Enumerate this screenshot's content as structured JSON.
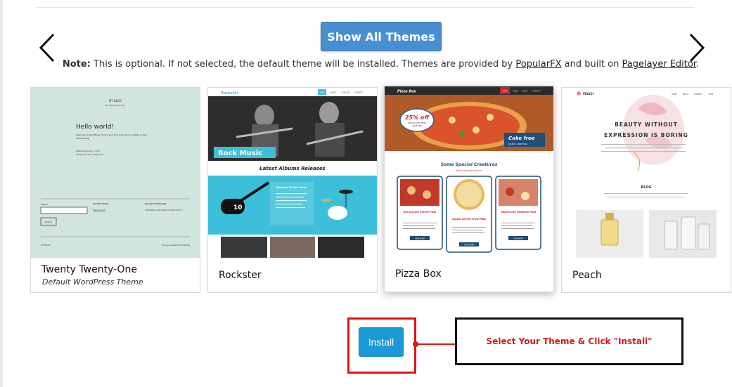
{
  "nav": {
    "prev_icon": "chevron-left-icon",
    "next_icon": "chevron-right-icon"
  },
  "show_all_button": "Show All Themes",
  "note": {
    "label": "Note:",
    "text1": " This is optional. If not selected, the default theme will be installed. Themes are provided by ",
    "link1": "PopularFX",
    "text2": " and built on ",
    "link2": "Pagelayer Editor",
    "text3": "."
  },
  "themes": [
    {
      "name": "Twenty Twenty-One",
      "subtitle": "Default WordPress Theme",
      "preview": {
        "site_title": "MY BLOG",
        "site_tagline": "My WordPress Blog",
        "post_title": "Hello world!",
        "post_excerpt1": "Welcome to WordPress. This is your first post. Edit or delete it, then",
        "post_excerpt2": "start writing!",
        "post_meta1": "Published January 3, 2022",
        "post_meta2": "Categorized as Uncategorized",
        "search_label": "Search",
        "search_button": "Search",
        "recent_posts_title": "Recent Posts",
        "recent_posts_item": "Hello world!",
        "recent_comments_title": "Recent Comments",
        "recent_comments_item": "A WordPress Commenter on Hello world!",
        "footer_left": "MY BLOG",
        "footer_right": "Proudly powered by WordPress"
      },
      "bg": "#d1e4dd"
    },
    {
      "name": "Rockster",
      "subtitle": "",
      "preview": {
        "logo": "Rockster",
        "menu": [
          "HOME",
          "ABOUT",
          "GALLERY",
          "CONTACT"
        ],
        "hero_label": "Rock Music",
        "section_title": "Latest Albums Releases",
        "band_title": "Welcome To Our Band"
      },
      "accent": "#3dbfd9"
    },
    {
      "name": "Pizza Box",
      "subtitle": "",
      "preview": {
        "logo": "Pizza Box",
        "menu": [
          "HOME",
          "MENU",
          "BLOG",
          "CONTACT"
        ],
        "badge_big": "25% off",
        "badge_line1": "ON YOUR FIRST ORDER",
        "badge_line2": "LARGE PIZZA",
        "promo_title": "Coke free",
        "promo_sub": "ON ANY LARGE PIZZA",
        "section_title": "Some Special Creatures",
        "section_sub": "WHAT WE MAKE FOR YOU",
        "items": [
          "Hot Dog and Cheese Pizza",
          "Double Cheese Crust Pizza",
          "Topped with Tomatoes Pizza"
        ],
        "item_button": "VIEW MORE"
      },
      "accent": "#c2272d"
    },
    {
      "name": "Peach",
      "subtitle": "",
      "preview": {
        "logo": "PEACH",
        "menu": [
          "HOME",
          "ABOUT",
          "CONTACT",
          "SHOP"
        ],
        "hero_line1": "BEAUTY WITHOUT",
        "hero_line2": "EXPRESSION IS BORING",
        "blog_title": "BLOG"
      },
      "accent": "#e2889a"
    }
  ],
  "install_button": "Install",
  "callout": "Select Your Theme & Click \"Install\""
}
